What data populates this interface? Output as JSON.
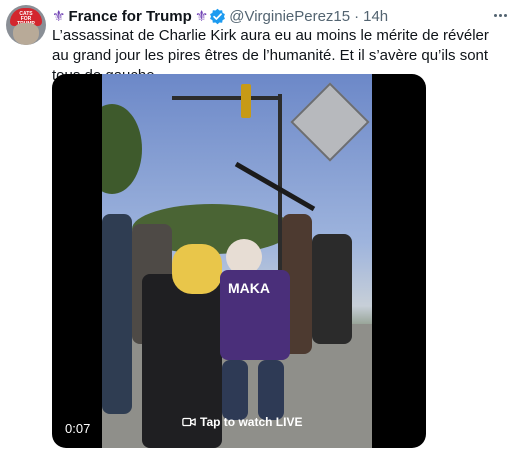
{
  "tweet": {
    "avatar_text": "CATS FOR TRUMP",
    "display_name": "France for Trump",
    "handle": "@VirginiePerez15",
    "separator": "·",
    "time": "14h",
    "body": "L’assassinat de Charlie Kirk aura eu au moins le mérite de révéler au grand jour les pires êtres de l’humanité. Et il s’avère qu’ils sont tous de gauche"
  },
  "video": {
    "timestamp": "0:07",
    "cta_label": "Tap to watch LIVE",
    "shirt_text": "MAKA"
  },
  "icons": [
    "fleur-de-lis-icon",
    "verified-badge-icon",
    "more-icon",
    "video-camera-icon"
  ],
  "colors": {
    "verified": "#1d9bf0",
    "fleur": "#6e3fb3",
    "secondary_text": "#536471"
  }
}
